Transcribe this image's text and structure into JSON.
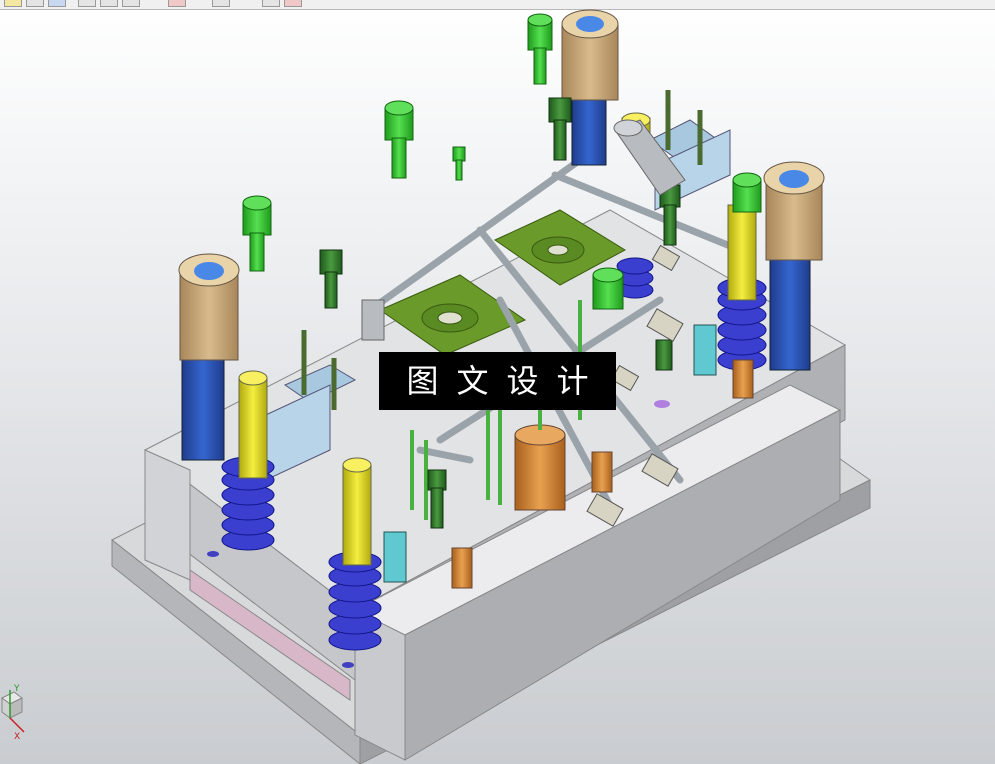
{
  "watermark": {
    "text": "图文设计"
  },
  "view_triad": {
    "y_label": "Y",
    "x_label": "X"
  },
  "toolbar": {
    "buttons": [
      "select-icon",
      "view-icon",
      "cube-icon",
      "arrow-icon",
      "line-icon",
      "rotate-icon",
      "move-icon",
      "dimension-icon",
      "snap-icon",
      "plane-icon"
    ]
  },
  "colors": {
    "background": "#e6e8ea",
    "plate": "#dcdcde",
    "plate_side": "#a8a9ac",
    "screw_green": "#3fd23a",
    "dark_green_screw": "#2f7f2a",
    "spring_blue": "#3a3fd0",
    "guide_bushing_tan": "#c8a878",
    "guide_pillar_blue": "#2a4fb0",
    "cavity_green": "#6a9a2a",
    "pin_yellow": "#e8e020",
    "cooling_pipe": "#b0b8c0",
    "cyan_part": "#60c8d0",
    "orange_pin": "#d88a30",
    "light_blue_block": "#a8c8e0"
  }
}
